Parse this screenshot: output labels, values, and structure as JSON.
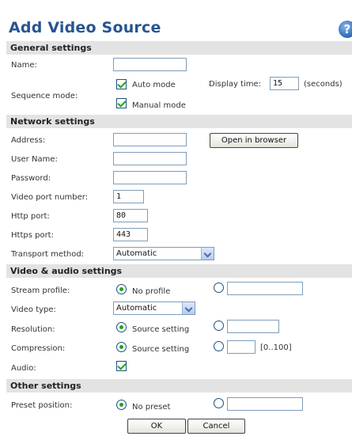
{
  "title": "Add Video Source",
  "help_icon": "?",
  "sections": {
    "general": "General settings",
    "network": "Network settings",
    "video_audio": "Video & audio settings",
    "other": "Other settings"
  },
  "general": {
    "name_label": "Name:",
    "name_value": "",
    "sequence_label": "Sequence mode:",
    "auto_mode": "Auto mode",
    "manual_mode": "Manual mode",
    "display_time_label": "Display time:",
    "display_time_value": "15",
    "seconds": "(seconds)"
  },
  "network": {
    "address_label": "Address:",
    "address_value": "",
    "open_browser": "Open in browser",
    "username_label": "User Name:",
    "username_value": "",
    "password_label": "Password:",
    "password_value": "",
    "video_port_label": "Video port number:",
    "video_port_value": "1",
    "http_port_label": "Http port:",
    "http_port_value": "80",
    "https_port_label": "Https port:",
    "https_port_value": "443",
    "transport_label": "Transport method:",
    "transport_value": "Automatic"
  },
  "video_audio": {
    "stream_label": "Stream profile:",
    "no_profile": "No profile",
    "stream_custom_value": "",
    "video_type_label": "Video type:",
    "video_type_value": "Automatic",
    "resolution_label": "Resolution:",
    "resolution_source": "Source setting",
    "resolution_custom_value": "",
    "compression_label": "Compression:",
    "compression_source": "Source setting",
    "compression_custom_value": "",
    "compression_range": "[0..100]",
    "audio_label": "Audio:"
  },
  "other": {
    "preset_label": "Preset position:",
    "no_preset": "No preset",
    "preset_custom_value": ""
  },
  "buttons": {
    "ok": "OK",
    "cancel": "Cancel"
  },
  "colors": {
    "title": "#275590",
    "section_bg": "#e3e3e3",
    "check": "#21a121"
  }
}
